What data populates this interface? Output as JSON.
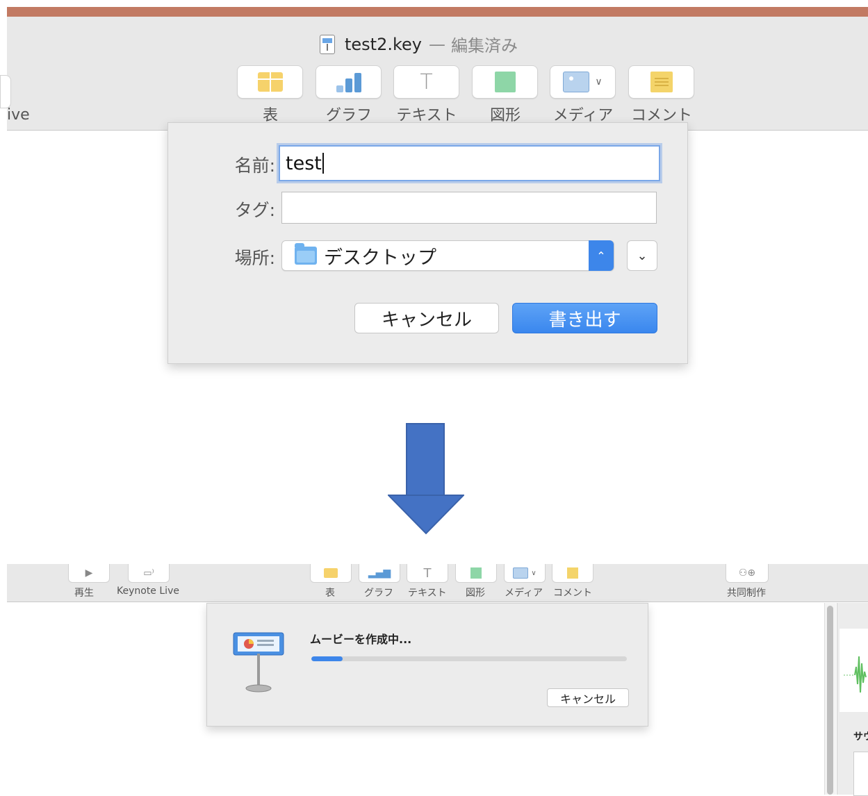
{
  "top_window": {
    "title": "test2.key",
    "title_separator": "—",
    "status": "編集済み",
    "live_label_partial": "ive",
    "toolbar": {
      "items": [
        {
          "label": "表",
          "icon": "table-icon"
        },
        {
          "label": "グラフ",
          "icon": "chart-icon"
        },
        {
          "label": "テキスト",
          "icon": "text-icon"
        },
        {
          "label": "図形",
          "icon": "shape-icon"
        },
        {
          "label": "メディア",
          "icon": "media-icon"
        },
        {
          "label": "コメント",
          "icon": "comment-icon"
        }
      ]
    },
    "export_dialog": {
      "name_label": "名前:",
      "name_value": "test",
      "tags_label": "タグ:",
      "tags_value": "",
      "location_label": "場所:",
      "location_value": "デスクトップ",
      "cancel_label": "キャンセル",
      "export_label": "書き出す"
    }
  },
  "bottom_window": {
    "toolbar": {
      "play_label": "再生",
      "keynote_live_label": "Keynote Live",
      "items": [
        {
          "label": "表"
        },
        {
          "label": "グラフ"
        },
        {
          "label": "テキスト"
        },
        {
          "label": "図形"
        },
        {
          "label": "メディア"
        },
        {
          "label": "コメント"
        }
      ],
      "collaborate_label": "共同制作"
    },
    "progress_dialog": {
      "title": "ムービーを作成中...",
      "progress": 0.1,
      "cancel_label": "キャンセル"
    },
    "inspector_partial_label": "サウ"
  },
  "colors": {
    "accent_blue": "#3d86ea",
    "arrow_blue": "#4472c4",
    "title_stripe": "#c27a63"
  }
}
